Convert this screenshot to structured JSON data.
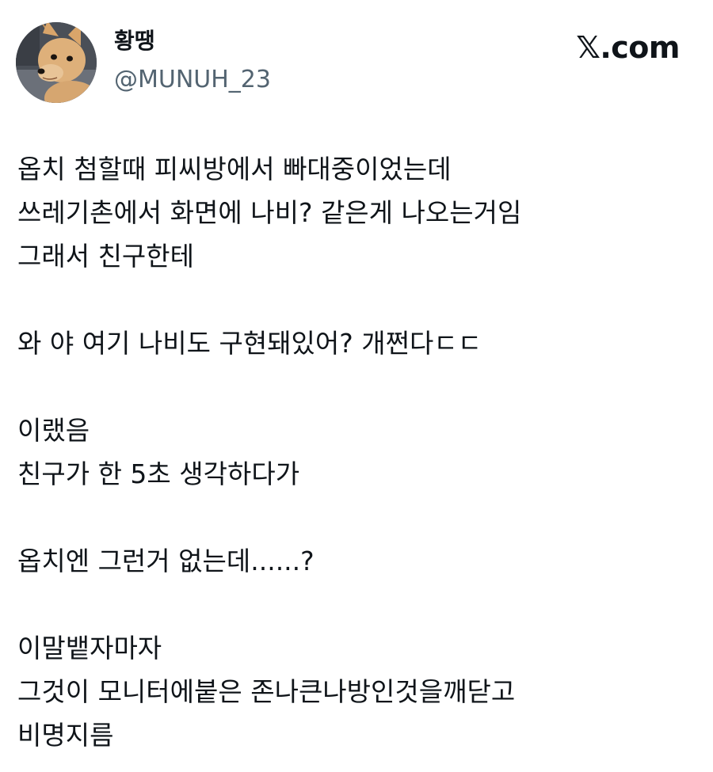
{
  "author": {
    "display_name": "황땡",
    "handle": "@MUNUH_23",
    "avatar_icon": "chihuahua-avatar"
  },
  "brand": {
    "label": "𝕏.com"
  },
  "tweet": {
    "lines": [
      "옵치 첨할때 피씨방에서 빠대중이었는데",
      "쓰레기촌에서 화면에 나비? 같은게 나오는거임",
      "그래서 친구한테",
      "",
      "와 야 여기 나비도 구현돼있어? 개쩐다ㄷㄷ",
      "",
      "이랬음",
      "친구가 한 5초 생각하다가",
      "",
      "옵치엔 그런거 없는데......?",
      "",
      "이말뱉자마자",
      "그것이 모니터에붙은 존나큰나방인것을깨닫고",
      "비명지름"
    ]
  }
}
